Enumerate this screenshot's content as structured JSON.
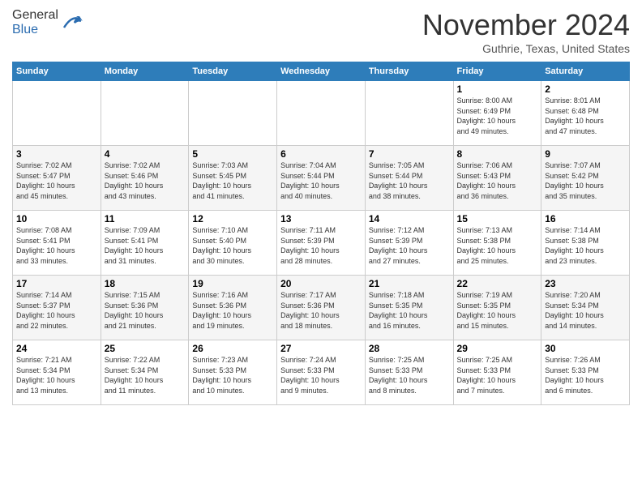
{
  "header": {
    "logo_general": "General",
    "logo_blue": "Blue",
    "month": "November 2024",
    "location": "Guthrie, Texas, United States"
  },
  "days_of_week": [
    "Sunday",
    "Monday",
    "Tuesday",
    "Wednesday",
    "Thursday",
    "Friday",
    "Saturday"
  ],
  "weeks": [
    [
      {
        "day": "",
        "info": ""
      },
      {
        "day": "",
        "info": ""
      },
      {
        "day": "",
        "info": ""
      },
      {
        "day": "",
        "info": ""
      },
      {
        "day": "",
        "info": ""
      },
      {
        "day": "1",
        "info": "Sunrise: 8:00 AM\nSunset: 6:49 PM\nDaylight: 10 hours\nand 49 minutes."
      },
      {
        "day": "2",
        "info": "Sunrise: 8:01 AM\nSunset: 6:48 PM\nDaylight: 10 hours\nand 47 minutes."
      }
    ],
    [
      {
        "day": "3",
        "info": "Sunrise: 7:02 AM\nSunset: 5:47 PM\nDaylight: 10 hours\nand 45 minutes."
      },
      {
        "day": "4",
        "info": "Sunrise: 7:02 AM\nSunset: 5:46 PM\nDaylight: 10 hours\nand 43 minutes."
      },
      {
        "day": "5",
        "info": "Sunrise: 7:03 AM\nSunset: 5:45 PM\nDaylight: 10 hours\nand 41 minutes."
      },
      {
        "day": "6",
        "info": "Sunrise: 7:04 AM\nSunset: 5:44 PM\nDaylight: 10 hours\nand 40 minutes."
      },
      {
        "day": "7",
        "info": "Sunrise: 7:05 AM\nSunset: 5:44 PM\nDaylight: 10 hours\nand 38 minutes."
      },
      {
        "day": "8",
        "info": "Sunrise: 7:06 AM\nSunset: 5:43 PM\nDaylight: 10 hours\nand 36 minutes."
      },
      {
        "day": "9",
        "info": "Sunrise: 7:07 AM\nSunset: 5:42 PM\nDaylight: 10 hours\nand 35 minutes."
      }
    ],
    [
      {
        "day": "10",
        "info": "Sunrise: 7:08 AM\nSunset: 5:41 PM\nDaylight: 10 hours\nand 33 minutes."
      },
      {
        "day": "11",
        "info": "Sunrise: 7:09 AM\nSunset: 5:41 PM\nDaylight: 10 hours\nand 31 minutes."
      },
      {
        "day": "12",
        "info": "Sunrise: 7:10 AM\nSunset: 5:40 PM\nDaylight: 10 hours\nand 30 minutes."
      },
      {
        "day": "13",
        "info": "Sunrise: 7:11 AM\nSunset: 5:39 PM\nDaylight: 10 hours\nand 28 minutes."
      },
      {
        "day": "14",
        "info": "Sunrise: 7:12 AM\nSunset: 5:39 PM\nDaylight: 10 hours\nand 27 minutes."
      },
      {
        "day": "15",
        "info": "Sunrise: 7:13 AM\nSunset: 5:38 PM\nDaylight: 10 hours\nand 25 minutes."
      },
      {
        "day": "16",
        "info": "Sunrise: 7:14 AM\nSunset: 5:38 PM\nDaylight: 10 hours\nand 23 minutes."
      }
    ],
    [
      {
        "day": "17",
        "info": "Sunrise: 7:14 AM\nSunset: 5:37 PM\nDaylight: 10 hours\nand 22 minutes."
      },
      {
        "day": "18",
        "info": "Sunrise: 7:15 AM\nSunset: 5:36 PM\nDaylight: 10 hours\nand 21 minutes."
      },
      {
        "day": "19",
        "info": "Sunrise: 7:16 AM\nSunset: 5:36 PM\nDaylight: 10 hours\nand 19 minutes."
      },
      {
        "day": "20",
        "info": "Sunrise: 7:17 AM\nSunset: 5:36 PM\nDaylight: 10 hours\nand 18 minutes."
      },
      {
        "day": "21",
        "info": "Sunrise: 7:18 AM\nSunset: 5:35 PM\nDaylight: 10 hours\nand 16 minutes."
      },
      {
        "day": "22",
        "info": "Sunrise: 7:19 AM\nSunset: 5:35 PM\nDaylight: 10 hours\nand 15 minutes."
      },
      {
        "day": "23",
        "info": "Sunrise: 7:20 AM\nSunset: 5:34 PM\nDaylight: 10 hours\nand 14 minutes."
      }
    ],
    [
      {
        "day": "24",
        "info": "Sunrise: 7:21 AM\nSunset: 5:34 PM\nDaylight: 10 hours\nand 13 minutes."
      },
      {
        "day": "25",
        "info": "Sunrise: 7:22 AM\nSunset: 5:34 PM\nDaylight: 10 hours\nand 11 minutes."
      },
      {
        "day": "26",
        "info": "Sunrise: 7:23 AM\nSunset: 5:33 PM\nDaylight: 10 hours\nand 10 minutes."
      },
      {
        "day": "27",
        "info": "Sunrise: 7:24 AM\nSunset: 5:33 PM\nDaylight: 10 hours\nand 9 minutes."
      },
      {
        "day": "28",
        "info": "Sunrise: 7:25 AM\nSunset: 5:33 PM\nDaylight: 10 hours\nand 8 minutes."
      },
      {
        "day": "29",
        "info": "Sunrise: 7:25 AM\nSunset: 5:33 PM\nDaylight: 10 hours\nand 7 minutes."
      },
      {
        "day": "30",
        "info": "Sunrise: 7:26 AM\nSunset: 5:33 PM\nDaylight: 10 hours\nand 6 minutes."
      }
    ]
  ]
}
